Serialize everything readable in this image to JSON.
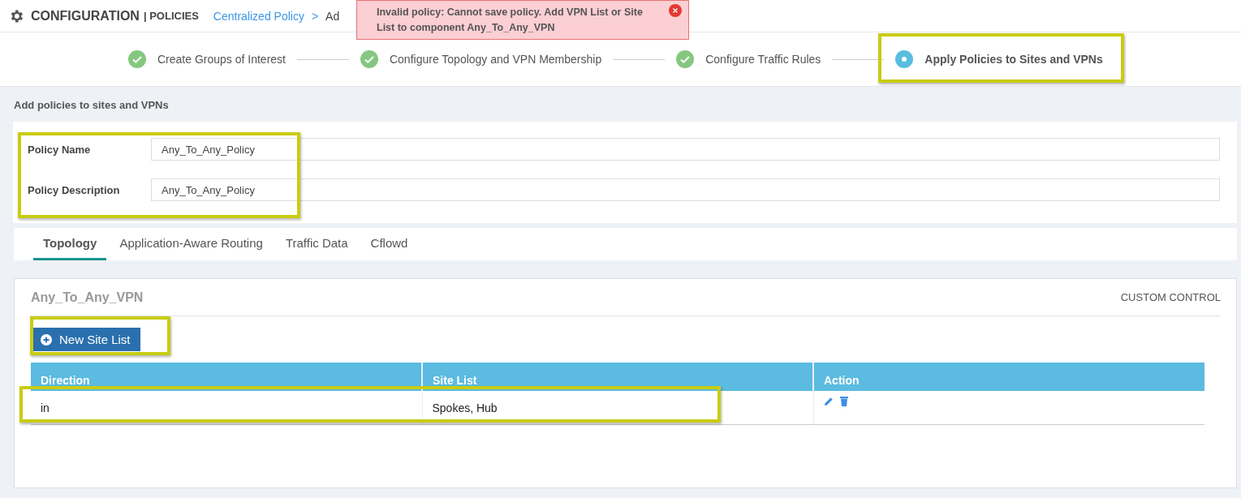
{
  "header": {
    "section": "CONFIGURATION",
    "divider": "|",
    "subsection": "POLICIES",
    "breadcrumb_link": "Centralized Policy",
    "breadcrumb_separator": ">",
    "breadcrumb_current": "Ad"
  },
  "toast": {
    "kind": "error",
    "message": "Invalid policy: Cannot save policy. Add VPN List or Site List to component Any_To_Any_VPN"
  },
  "steps": [
    {
      "label": "Create Groups of Interest",
      "done": true,
      "selected": false
    },
    {
      "label": "Configure Topology and VPN Membership",
      "done": true,
      "selected": false
    },
    {
      "label": "Configure Traffic Rules",
      "done": true,
      "selected": false
    },
    {
      "label": "Apply Policies to Sites and VPNs",
      "done": false,
      "selected": true
    }
  ],
  "page_heading": "Add policies to sites and VPNs",
  "form": {
    "fields": [
      {
        "label": "Policy Name",
        "value": "Any_To_Any_Policy"
      },
      {
        "label": "Policy Description",
        "value": "Any_To_Any_Policy"
      }
    ]
  },
  "tabs": [
    {
      "label": "Topology",
      "selected": true
    },
    {
      "label": "Application-Aware Routing",
      "selected": false
    },
    {
      "label": "Traffic Data",
      "selected": false
    },
    {
      "label": "Cflowd",
      "selected": false
    }
  ],
  "vpn_panel": {
    "title": "Any_To_Any_VPN",
    "custom_control": "CUSTOM CONTROL",
    "button": "New Site List",
    "table": {
      "columns": [
        "Direction",
        "Site List",
        "Action"
      ],
      "rows": [
        {
          "direction": "in",
          "site_list": "Spokes, Hub"
        }
      ]
    }
  }
}
